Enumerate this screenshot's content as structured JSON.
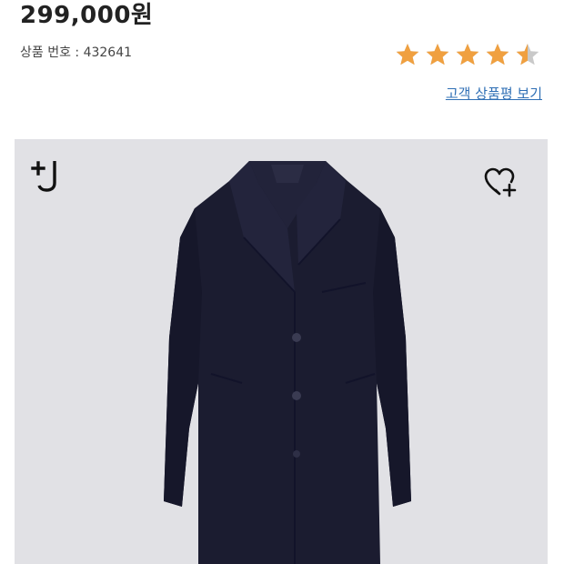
{
  "product": {
    "price": "299,000원",
    "id_label": "상품 번호 : 432641"
  },
  "rating": {
    "value": 4.5,
    "max": 5,
    "star_color": "#f0a040",
    "empty_color": "#c9c9c9"
  },
  "review_link": {
    "label": "고객 상품평 보기"
  },
  "image": {
    "background": "#e1e1e5",
    "brand_icon": "plus-j-logo-icon",
    "wishlist_icon": "heart-plus-icon",
    "subject": "navy-chesterfield-coat"
  }
}
